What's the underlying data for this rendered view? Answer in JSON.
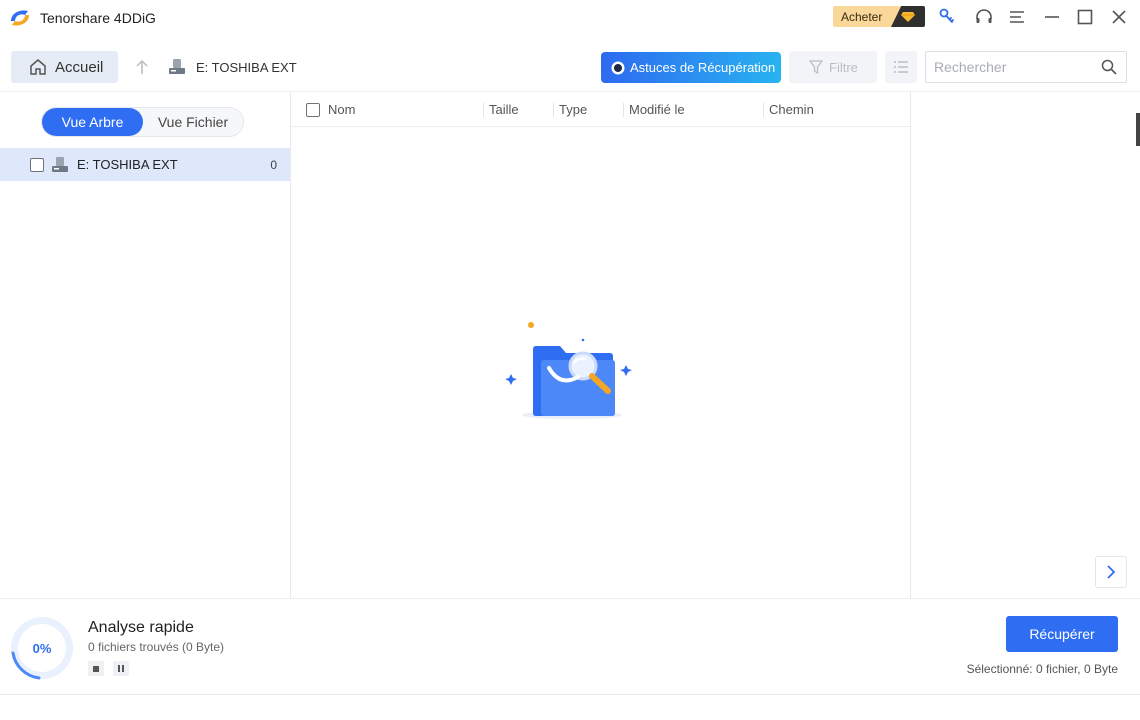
{
  "app": {
    "title": "Tenorshare 4DDiG"
  },
  "titlebar": {
    "buy_label": "Acheter"
  },
  "toolbar": {
    "home_label": "Accueil",
    "drive_label": "E: TOSHIBA EXT",
    "tips_label": "Astuces de Récupération",
    "filter_label": "Filtre",
    "search_placeholder": "Rechercher"
  },
  "sidebar": {
    "view_tabs": [
      {
        "label": "Vue Arbre",
        "active": true
      },
      {
        "label": "Vue Fichier",
        "active": false
      }
    ],
    "tree": [
      {
        "label": "E: TOSHIBA EXT",
        "count": "0"
      }
    ]
  },
  "table": {
    "columns": [
      "Nom",
      "Taille",
      "Type",
      "Modifié le",
      "Chemin"
    ]
  },
  "status": {
    "progress": "0%",
    "progress_fraction": 0,
    "scan_title": "Analyse rapide",
    "scan_sub": "0 fichiers trouvés (0 Byte)",
    "recover_label": "Récupérer",
    "selected_text": "Sélectionné: 0 fichier, 0 Byte"
  },
  "colors": {
    "accent": "#2f6ef3",
    "tips_gradient_end": "#28b3f0",
    "buy_bg": "#f9d89a",
    "tree_selected_bg": "#dfe8fb"
  },
  "icons": {
    "app_logo": "app-logo-icon",
    "buy": "diamond-icon",
    "key": "key-icon",
    "support": "headset-icon",
    "menu": "hamburger-menu-icon",
    "minimize": "minimize-icon",
    "maximize": "maximize-icon",
    "close": "close-icon",
    "home": "home-icon",
    "up": "up-arrow-icon",
    "drive": "drive-icon",
    "tips": "chat-bubble-icon",
    "filter": "funnel-icon",
    "list": "list-view-icon",
    "search": "search-icon",
    "next": "chevron-right-icon",
    "stop": "stop-icon",
    "pause": "pause-icon"
  }
}
